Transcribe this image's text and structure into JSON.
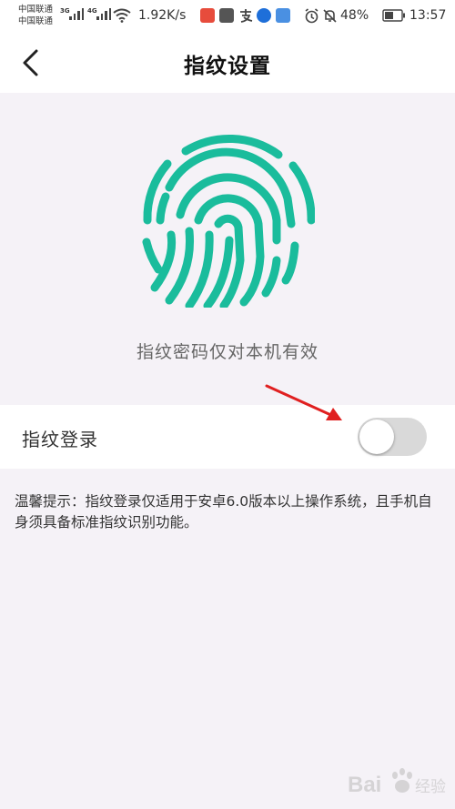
{
  "status_bar": {
    "carrier1": "中国联通",
    "carrier2": "中国联通",
    "sig1_tag": "3G",
    "sig2_tag": "4G",
    "net_speed": "1.92K/s",
    "battery": "48%",
    "time": "13:57"
  },
  "header": {
    "title": "指纹设置"
  },
  "fingerprint": {
    "caption": "指纹密码仅对本机有效",
    "color": "#1abc9c"
  },
  "setting": {
    "label": "指纹登录",
    "enabled": false
  },
  "tip": {
    "text": "温馨提示：指纹登录仅适用于安卓6.0版本以上操作系统，且手机自身须具备标准指纹识别功能。"
  },
  "colors": {
    "accent": "#1abc9c",
    "arrow": "#e02020"
  },
  "watermark": {
    "text": "Bai 经验"
  }
}
